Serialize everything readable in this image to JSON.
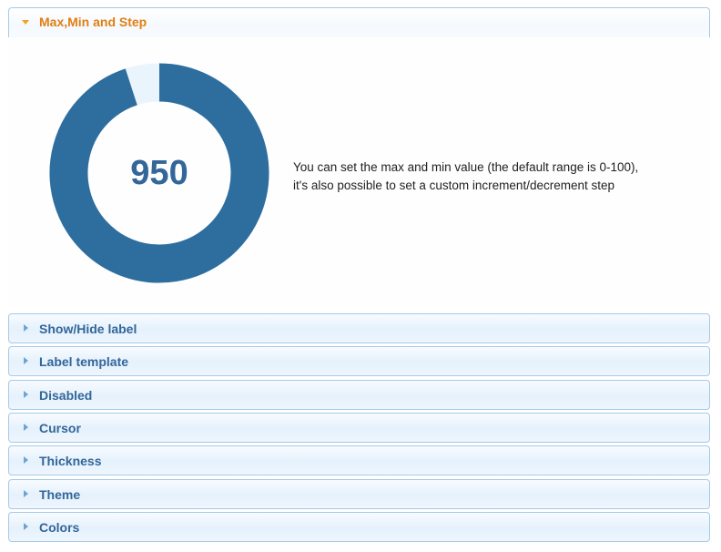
{
  "accordion": {
    "active_panel": {
      "title": "Max,Min and Step",
      "knob": {
        "value_text": "950",
        "value": 950,
        "min": 0,
        "max": 1000,
        "track_color": "#eaf4fd",
        "fill_color": "#2e6e9e",
        "text_color": "#336699"
      },
      "description_line1": "You can set the max and min value (the default range is 0-100),",
      "description_line2": "it's also possible to set a custom increment/decrement step"
    },
    "panels": [
      {
        "title": "Show/Hide label"
      },
      {
        "title": "Label template"
      },
      {
        "title": "Disabled"
      },
      {
        "title": "Cursor"
      },
      {
        "title": "Thickness"
      },
      {
        "title": "Theme"
      },
      {
        "title": "Colors"
      }
    ]
  }
}
